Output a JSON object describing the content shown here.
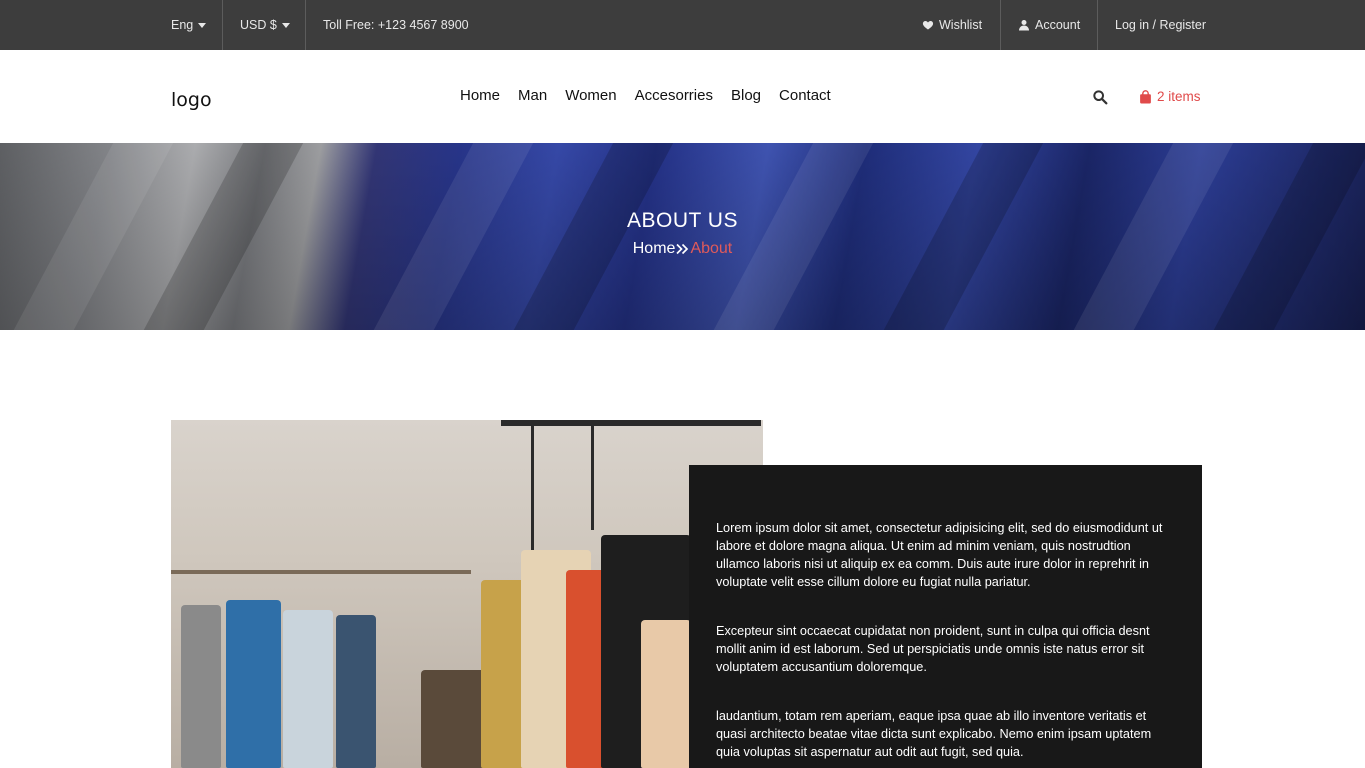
{
  "topbar": {
    "language": "Eng",
    "currency": "USD $",
    "toll_free": "Toll Free: +123 4567 8900",
    "wishlist": "Wishlist",
    "account": "Account",
    "login_register": "Log in / Register"
  },
  "header": {
    "logo": "logo",
    "nav": [
      "Home",
      "Man",
      "Women",
      "Accesorries",
      "Blog",
      "Contact"
    ],
    "cart_label": "2 items"
  },
  "banner": {
    "title": "ABOUT US",
    "breadcrumb_home": "Home",
    "breadcrumb_current": "About"
  },
  "about": {
    "paragraphs": [
      "Lorem ipsum dolor sit amet, consectetur adipisicing elit, sed do eiusmodidunt ut labore et dolore magna aliqua. Ut enim ad minim veniam, quis nostrudtion ullamco laboris nisi ut aliquip ex ea comm. Duis aute irure dolor in reprehrit in voluptate velit esse cillum dolore eu fugiat nulla pariatur.",
      "Excepteur sint occaecat cupidatat non proident, sunt in culpa qui officia desnt mollit anim id est laborum. Sed ut perspiciatis unde omnis iste natus error sit voluptatem accusantium doloremque.",
      "laudantium, totam rem aperiam, eaque ipsa quae ab illo inventore veritatis et quasi architecto beatae vitae dicta sunt explicabo. Nemo enim ipsam uptatem quia voluptas sit aspernatur aut odit aut fugit, sed quia."
    ]
  },
  "colors": {
    "topbar_bg": "#3d3d3d",
    "accent": "#e04a4a",
    "about_box_bg": "#181818"
  },
  "icons": {
    "language_dropdown": "chevron-down-icon",
    "currency_dropdown": "chevron-down-icon",
    "wishlist": "heart-icon",
    "account": "user-icon",
    "search": "search-icon",
    "cart": "shopping-bag-icon",
    "breadcrumb_separator": "double-chevron-right-icon"
  }
}
